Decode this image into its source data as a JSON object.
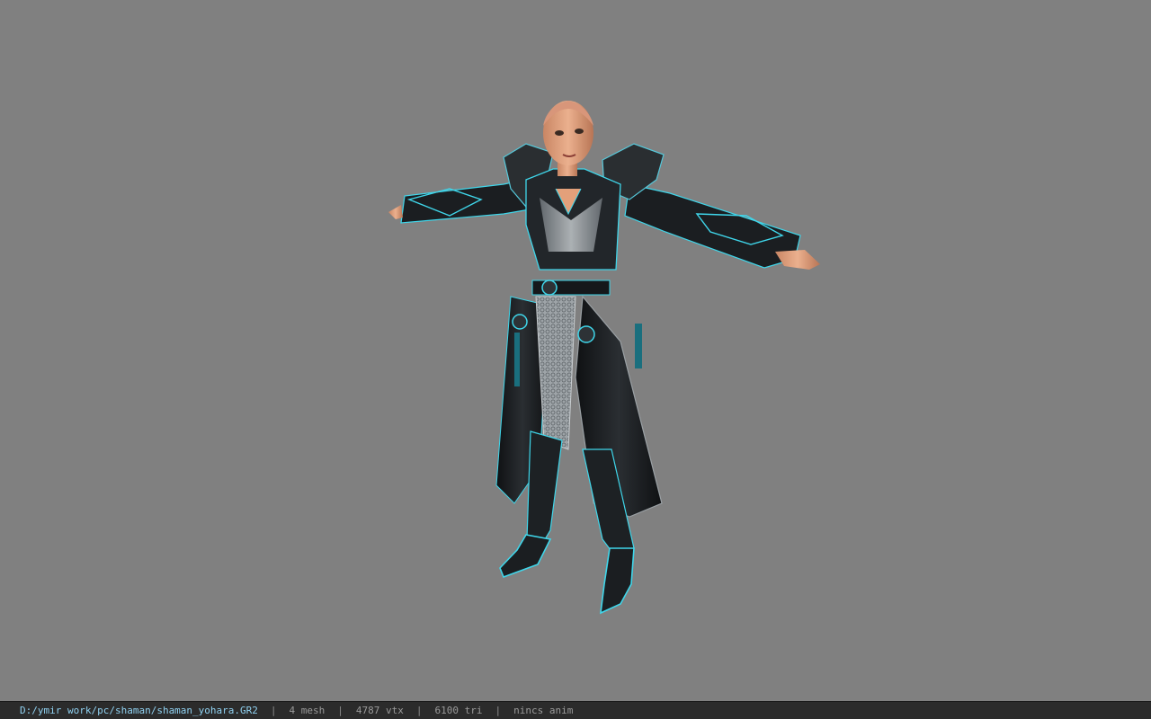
{
  "viewport": {
    "background_color": "#808080",
    "model_icon": "character-model-icon",
    "armor_accent_color": "#3fd6ea",
    "armor_base_color": "#1c1f22",
    "skin_color": "#e3a07a"
  },
  "status_bar": {
    "file_path": "D:/ymir work/pc/shaman/shaman_yohara.GR2",
    "separator": "|",
    "mesh": "4 mesh",
    "vertices": "4787 vtx",
    "triangles": "6100 tri",
    "animation": "nincs anim"
  }
}
